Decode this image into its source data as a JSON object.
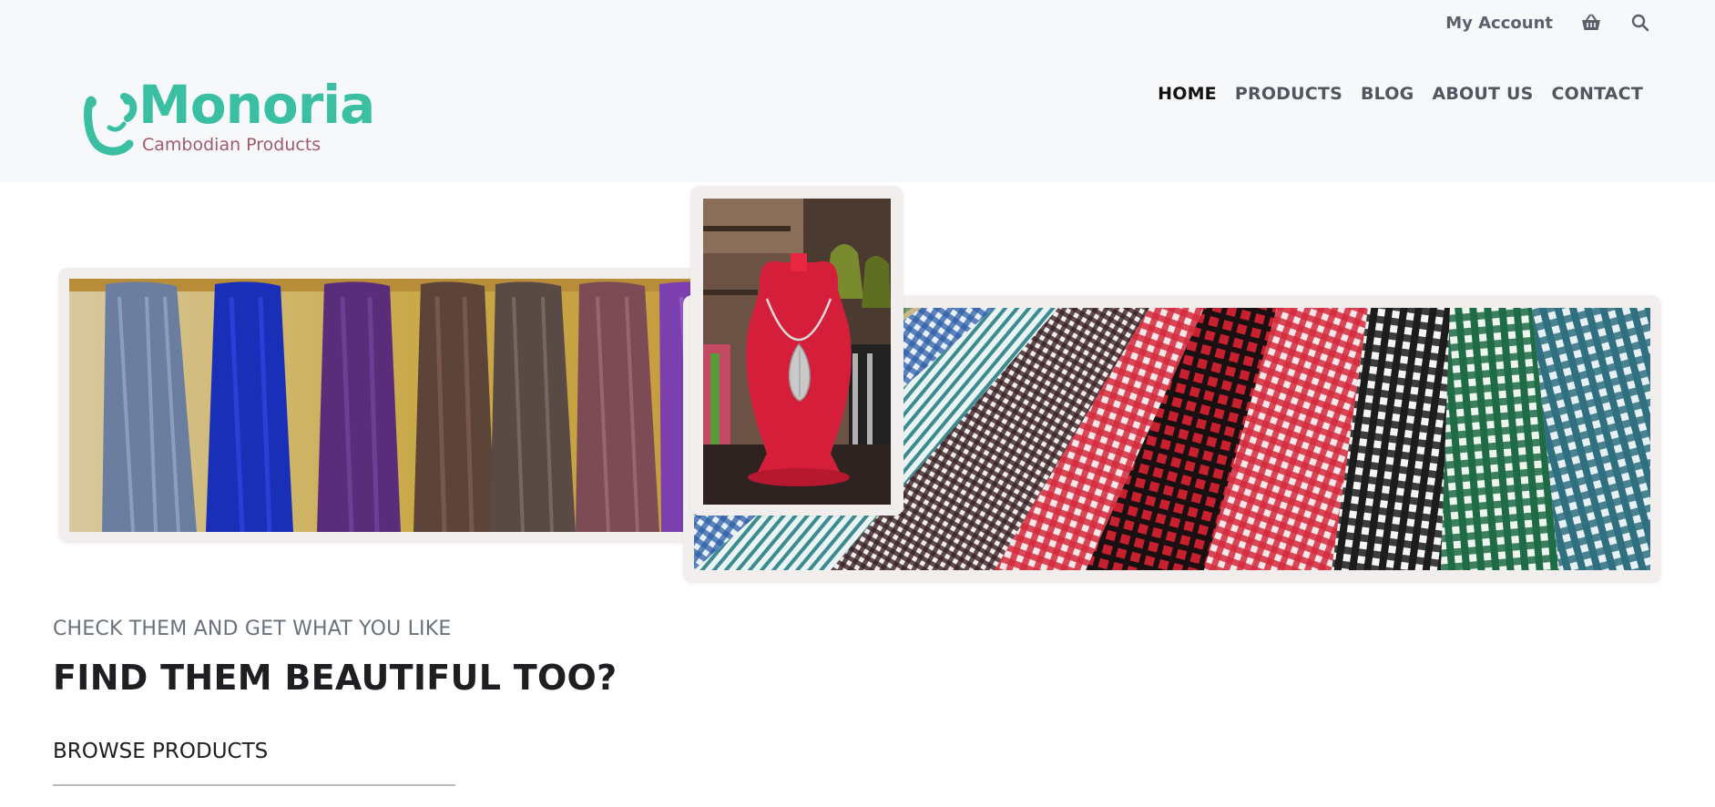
{
  "header": {
    "account_label": "My Account",
    "cart_icon": "basket-icon",
    "search_icon": "search-icon"
  },
  "logo": {
    "name": "Monoria",
    "tagline": "Cambodian Products",
    "colors": {
      "brand": "#3bbfa3",
      "tagline": "#a05a6a"
    }
  },
  "nav": {
    "items": [
      {
        "label": "HOME",
        "active": true
      },
      {
        "label": "PRODUCTS",
        "active": false
      },
      {
        "label": "BLOG",
        "active": false
      },
      {
        "label": "ABOUT US",
        "active": false
      },
      {
        "label": "CONTACT",
        "active": false
      }
    ]
  },
  "hero": {
    "images": [
      {
        "name": "silk-scarves-photo"
      },
      {
        "name": "necklace-display-photo"
      },
      {
        "name": "checkered-krama-photo"
      }
    ]
  },
  "content": {
    "subtitle": "CHECK THEM AND GET WHAT YOU LIKE",
    "title": "FIND THEM BEAUTIFUL TOO?",
    "cta_label": "BROWSE PRODUCTS"
  }
}
